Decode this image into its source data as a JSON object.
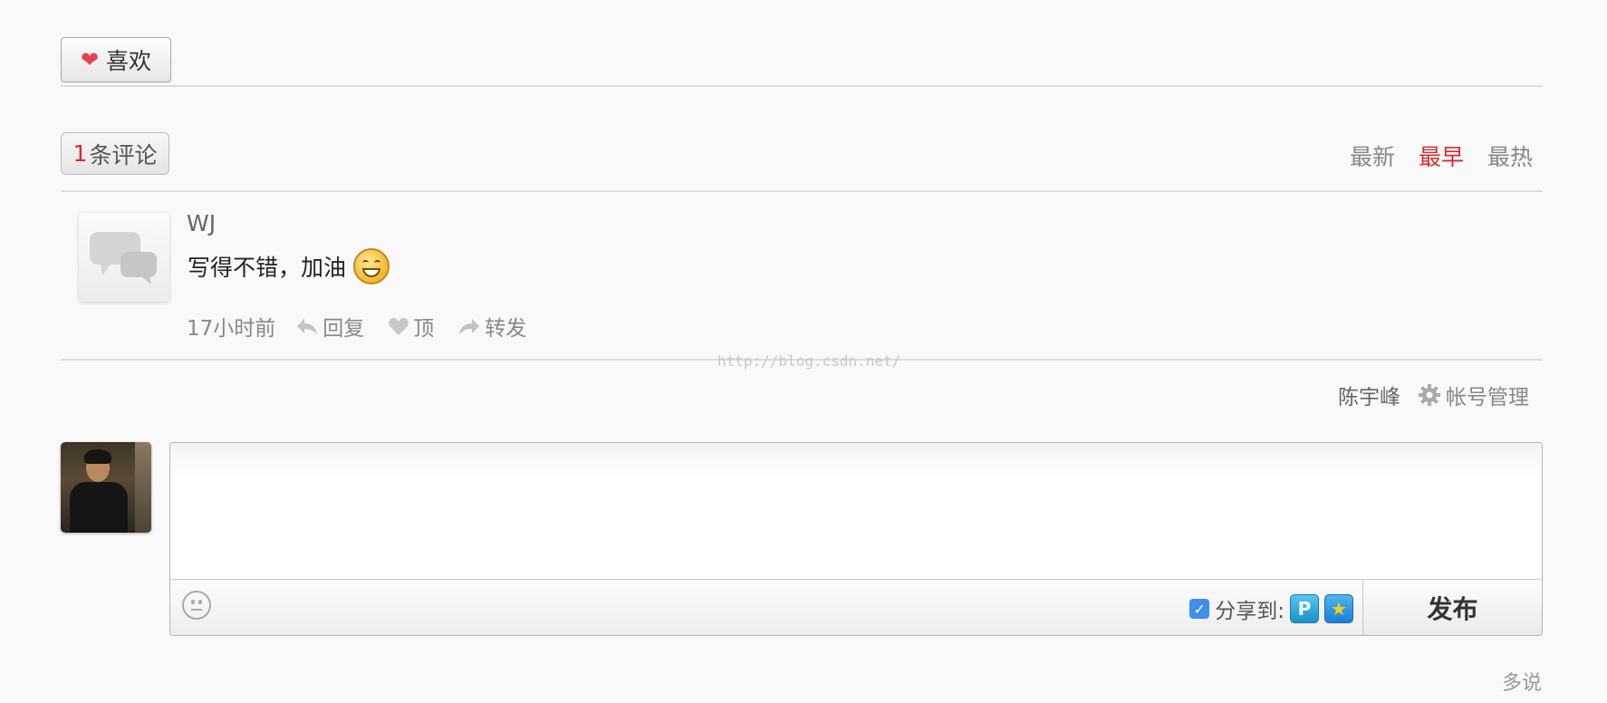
{
  "like": {
    "icon": "heart-icon",
    "label": "喜欢",
    "color": "#e8404f"
  },
  "comments": {
    "count": "1",
    "count_suffix": "条评论",
    "sort": {
      "newest": "最新",
      "earliest": "最早",
      "hottest": "最热",
      "active": "最早"
    },
    "items": [
      {
        "author": "WJ",
        "text": "写得不错，加油",
        "emoji": "grin-emoji",
        "time": "17小时前",
        "reply": "回复",
        "up": "顶",
        "forward": "转发"
      }
    ]
  },
  "watermark": "http://blog.csdn.net/",
  "user": {
    "name": "陈宇峰",
    "account": "帐号管理"
  },
  "editor": {
    "value": "",
    "share_label": "分享到:",
    "share_checked": true,
    "publish": "发布"
  },
  "footer": {
    "brand": "多说"
  },
  "colors": {
    "accent": "#d0302f",
    "checkbox": "#3f8fe8",
    "background": "#f9f9f9"
  }
}
